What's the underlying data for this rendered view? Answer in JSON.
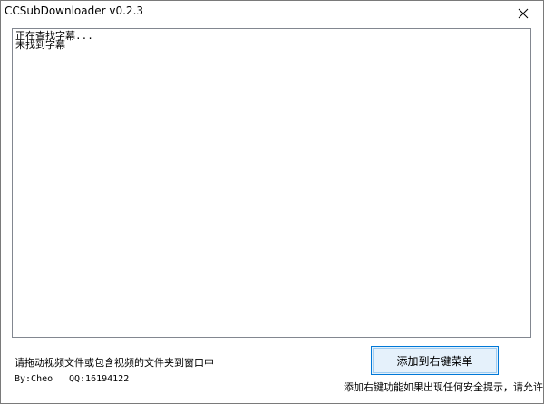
{
  "window": {
    "title": "CCSubDownloader v0.2.3",
    "close_icon": "close-icon"
  },
  "log": {
    "lines": [
      "正在查找字幕...",
      "未找到字幕"
    ]
  },
  "footer": {
    "hint": "请拖动视频文件或包含视频的文件夹到窗口中",
    "author": "By:Cheo",
    "qq": "QQ:16194122",
    "add_menu_label": "添加到右键菜单",
    "warning": "添加右键功能如果出现任何安全提示，请允许"
  },
  "colors": {
    "button_border": "#0078d7",
    "button_fill": "#e5f1fb",
    "text_border": "#828790"
  }
}
